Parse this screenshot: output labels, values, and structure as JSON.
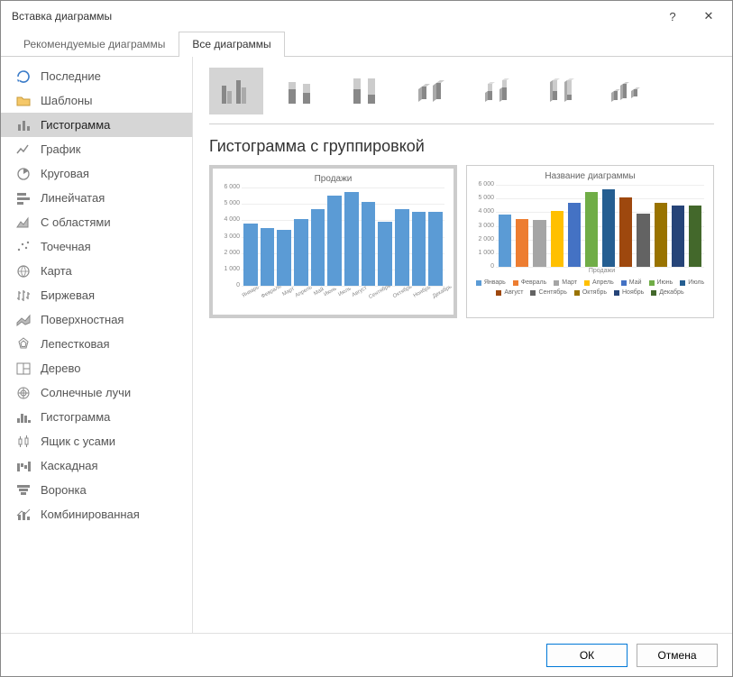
{
  "window": {
    "title": "Вставка диаграммы",
    "help": "?",
    "close": "✕"
  },
  "tabs": {
    "recommended": "Рекомендуемые диаграммы",
    "all": "Все диаграммы"
  },
  "sidebar": [
    {
      "label": "Последние"
    },
    {
      "label": "Шаблоны"
    },
    {
      "label": "Гистограмма"
    },
    {
      "label": "График"
    },
    {
      "label": "Круговая"
    },
    {
      "label": "Линейчатая"
    },
    {
      "label": "С областями"
    },
    {
      "label": "Точечная"
    },
    {
      "label": "Карта"
    },
    {
      "label": "Биржевая"
    },
    {
      "label": "Поверхностная"
    },
    {
      "label": "Лепестковая"
    },
    {
      "label": "Дерево"
    },
    {
      "label": "Солнечные лучи"
    },
    {
      "label": "Гистограмма"
    },
    {
      "label": "Ящик с усами"
    },
    {
      "label": "Каскадная"
    },
    {
      "label": "Воронка"
    },
    {
      "label": "Комбинированная"
    }
  ],
  "main": {
    "heading": "Гистограмма с группировкой"
  },
  "footer": {
    "ok": "ОК",
    "cancel": "Отмена"
  },
  "chart_data": [
    {
      "type": "bar",
      "title": "Продажи",
      "ylim": [
        0,
        6000
      ],
      "ytick": 1000,
      "categories": [
        "Январь",
        "Февраль",
        "Март",
        "Апрель",
        "Май",
        "Июнь",
        "Июль",
        "Август",
        "Сентябрь",
        "Октябрь",
        "Ноябрь",
        "Декабрь"
      ],
      "values": [
        3800,
        3500,
        3400,
        4100,
        4700,
        5500,
        5700,
        5100,
        3900,
        4700,
        4500,
        4500
      ],
      "color": "#5b9bd5"
    },
    {
      "type": "bar",
      "title": "Название диаграммы",
      "xlabel": "Продажи",
      "ylim": [
        0,
        6000
      ],
      "ytick": 1000,
      "categories": [
        "Январь",
        "Февраль",
        "Март",
        "Апрель",
        "Май",
        "Июнь",
        "Июль",
        "Август",
        "Сентябрь",
        "Октябрь",
        "Ноябрь",
        "Декабрь"
      ],
      "values": [
        3800,
        3500,
        3400,
        4100,
        4700,
        5500,
        5700,
        5100,
        3900,
        4700,
        4500,
        4500
      ],
      "colors": [
        "#5b9bd5",
        "#ed7d31",
        "#a5a5a5",
        "#ffc000",
        "#4472c4",
        "#70ad47",
        "#255e91",
        "#9e480e",
        "#636363",
        "#997300",
        "#264478",
        "#43682b"
      ]
    }
  ]
}
